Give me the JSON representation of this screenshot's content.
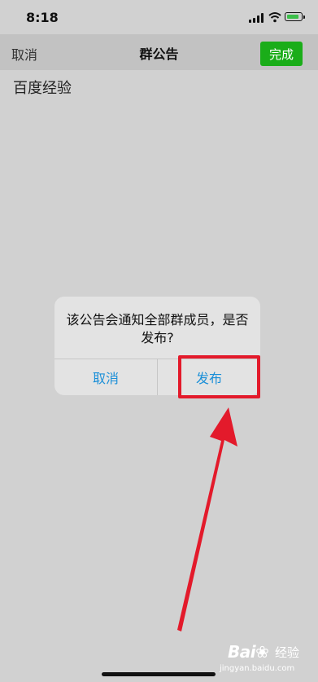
{
  "status_bar": {
    "time": "8:18"
  },
  "nav": {
    "cancel_label": "取消",
    "title": "群公告",
    "done_label": "完成"
  },
  "content": {
    "text": "百度经验"
  },
  "dialog": {
    "message": "该公告会通知全部群成员，是否发布?",
    "cancel_label": "取消",
    "publish_label": "发布"
  },
  "watermark": {
    "brand": "Bai",
    "brand_suffix": "经验",
    "url": "jingyan.baidu.com"
  },
  "colors": {
    "done_button": "#1aad19",
    "dialog_button_text": "#1a8fd8",
    "annotation_red": "#e31a2b"
  }
}
